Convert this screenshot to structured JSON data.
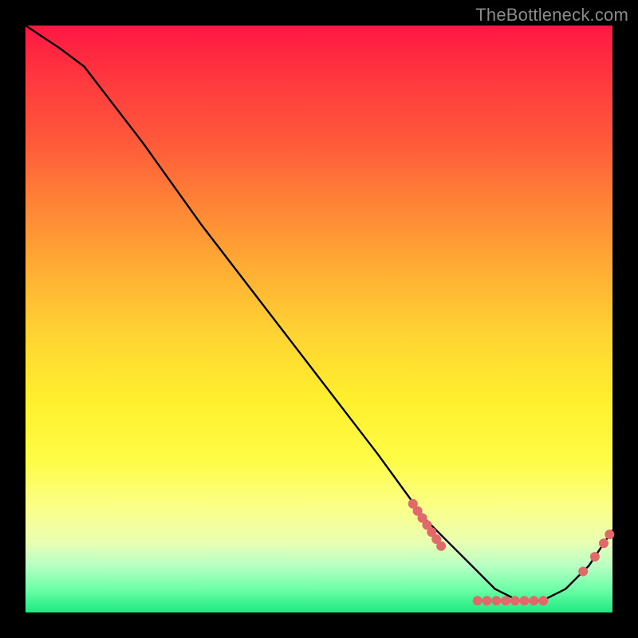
{
  "watermark": "TheBottleneck.com",
  "chart_data": {
    "type": "line",
    "title": "",
    "xlabel": "",
    "ylabel": "",
    "xlim": [
      0,
      100
    ],
    "ylim": [
      0,
      100
    ],
    "series": [
      {
        "name": "bottleneck-curve",
        "x": [
          0,
          6,
          10,
          20,
          30,
          40,
          50,
          60,
          68,
          72,
          76,
          80,
          84,
          88,
          92,
          96,
          100
        ],
        "values": [
          100,
          96,
          93,
          80,
          66,
          53,
          40,
          27,
          16,
          12,
          8,
          4,
          2,
          2,
          4,
          8,
          14
        ]
      }
    ],
    "markers": [
      {
        "x": 66.0,
        "y": 18.5
      },
      {
        "x": 66.8,
        "y": 17.3
      },
      {
        "x": 67.6,
        "y": 16.1
      },
      {
        "x": 68.4,
        "y": 14.9
      },
      {
        "x": 69.2,
        "y": 13.7
      },
      {
        "x": 70.0,
        "y": 12.5
      },
      {
        "x": 70.8,
        "y": 11.3
      },
      {
        "x": 77.0,
        "y": 2.0
      },
      {
        "x": 78.6,
        "y": 2.0
      },
      {
        "x": 80.2,
        "y": 2.0
      },
      {
        "x": 81.8,
        "y": 2.0
      },
      {
        "x": 83.4,
        "y": 2.0
      },
      {
        "x": 85.0,
        "y": 2.0
      },
      {
        "x": 86.6,
        "y": 2.0
      },
      {
        "x": 88.2,
        "y": 2.0
      },
      {
        "x": 95.0,
        "y": 7.0
      },
      {
        "x": 97.0,
        "y": 9.5
      },
      {
        "x": 98.5,
        "y": 11.8
      },
      {
        "x": 99.5,
        "y": 13.3
      }
    ],
    "marker_color": "#e06a6a",
    "line_color": "#000000"
  }
}
